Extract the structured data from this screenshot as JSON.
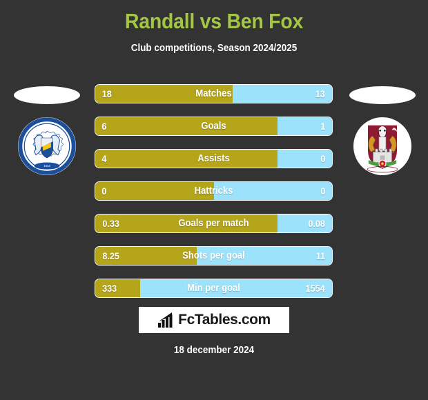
{
  "header": {
    "title": "Randall vs Ben Fox",
    "subtitle": "Club competitions, Season 2024/2025",
    "title_color": "#a3c644"
  },
  "colors": {
    "background": "#333333",
    "home_bar": "#b5a51b",
    "away_bar": "#9ce2fa",
    "text": "#ffffff"
  },
  "badges": {
    "home": {
      "name": "peterborough-united-football-club",
      "label": "PETERBOROUGH UNITED FOOTBALL CLUB",
      "year": "1934"
    },
    "away": {
      "name": "northampton-town-football-club",
      "label": "NORTHAMPTON TOWN FOOTBALL CLUB"
    }
  },
  "stats": [
    {
      "label": "Matches",
      "home": "18",
      "away": "13",
      "home_pct": 58
    },
    {
      "label": "Goals",
      "home": "6",
      "away": "1",
      "home_pct": 77
    },
    {
      "label": "Assists",
      "home": "4",
      "away": "0",
      "home_pct": 77
    },
    {
      "label": "Hattricks",
      "home": "0",
      "away": "0",
      "home_pct": 50
    },
    {
      "label": "Goals per match",
      "home": "0.33",
      "away": "0.08",
      "home_pct": 77
    },
    {
      "label": "Shots per goal",
      "home": "8.25",
      "away": "11",
      "home_pct": 43
    },
    {
      "label": "Min per goal",
      "home": "333",
      "away": "1554",
      "home_pct": 19
    }
  ],
  "branding": {
    "logo_text": "FcTables.com",
    "logo_icon": "bar-chart-icon"
  },
  "footer": {
    "date": "18 december 2024"
  }
}
